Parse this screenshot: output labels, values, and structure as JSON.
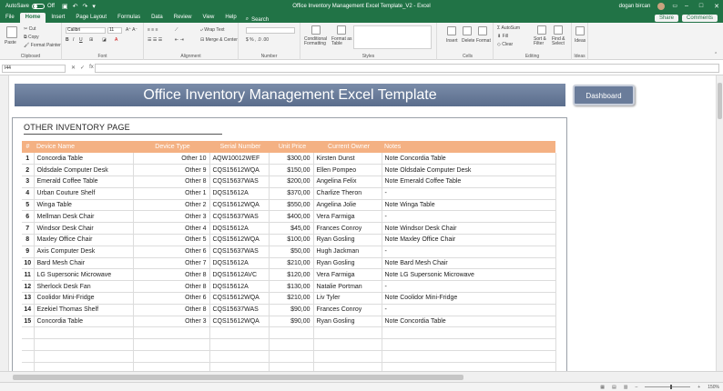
{
  "titlebar": {
    "autosave_label": "AutoSave",
    "autosave_state": "Off",
    "title": "Office Inventory Management Excel Template_V2 - Excel",
    "user": "dogan bircan"
  },
  "tabs": [
    "File",
    "Home",
    "Insert",
    "Page Layout",
    "Formulas",
    "Data",
    "Review",
    "View",
    "Help"
  ],
  "active_tab": "Home",
  "search_label": "Search",
  "share_label": "Share",
  "comments_label": "Comments",
  "ribbon": {
    "clipboard": {
      "paste": "Paste",
      "cut": "Cut",
      "copy": "Copy",
      "format_painter": "Format Painter",
      "label": "Clipboard"
    },
    "font": {
      "name": "Calibri",
      "size": "11",
      "label": "Font"
    },
    "alignment": {
      "wrap": "Wrap Text",
      "merge": "Merge & Center",
      "label": "Alignment"
    },
    "number": {
      "label": "Number"
    },
    "styles": {
      "conditional": "Conditional Formatting",
      "format_table": "Format as Table",
      "label": "Styles"
    },
    "cells": {
      "insert": "Insert",
      "delete": "Delete",
      "format": "Format",
      "label": "Cells"
    },
    "editing": {
      "autosum": "AutoSum",
      "fill": "Fill",
      "clear": "Clear",
      "sort": "Sort & Filter",
      "find": "Find & Select",
      "label": "Editing"
    },
    "ideas": {
      "ideas": "Ideas",
      "label": "Ideas"
    }
  },
  "formula_bar": {
    "name_box": "I44",
    "content": ""
  },
  "banner_title": "Office Inventory Management Excel Template",
  "dashboard_button": "Dashboard",
  "section_title": "OTHER INVENTORY PAGE",
  "table": {
    "headers": [
      "#",
      "Device Name",
      "Device Type",
      "Serial Number",
      "Unit Price",
      "Current Owner",
      "Notes"
    ],
    "rows": [
      [
        "1",
        "Concordia Table",
        "Other 10",
        "AQW10012WEF",
        "$300,00",
        "Kirsten Dunst",
        "Note Concordia Table"
      ],
      [
        "2",
        "Oldsdale Computer Desk",
        "Other 9",
        "CQS15612WQA",
        "$150,00",
        "Ellen Pompeo",
        "Note Oldsdale Computer Desk"
      ],
      [
        "3",
        "Emerald Coffee Table",
        "Other 8",
        "CQS15637WAS",
        "$200,00",
        "Angelina Felix",
        "Note Emerald Coffee Table"
      ],
      [
        "4",
        "Urban Couture Shelf",
        "Other 1",
        "DQS15612A",
        "$370,00",
        "Charlize Theron",
        "-"
      ],
      [
        "5",
        "Winga Table",
        "Other 2",
        "CQS15612WQA",
        "$550,00",
        "Angelina Jolie",
        "Note Winga Table"
      ],
      [
        "6",
        "Mellman Desk Chair",
        "Other 3",
        "CQS15637WAS",
        "$400,00",
        "Vera Farmiga",
        "-"
      ],
      [
        "7",
        "Windsor Desk Chair",
        "Other 4",
        "DQS15612A",
        "$45,00",
        "Frances Conroy",
        "Note Windsor Desk Chair"
      ],
      [
        "8",
        "Maxley Office Chair",
        "Other 5",
        "CQS15612WQA",
        "$100,00",
        "Ryan Gosling",
        "Note Maxley Office Chair"
      ],
      [
        "9",
        "Axis Computer Desk",
        "Other 6",
        "CQS15637WAS",
        "$50,00",
        "Hugh Jackman",
        "-"
      ],
      [
        "10",
        "Bard Mesh Chair",
        "Other 7",
        "DQS15612A",
        "$210,00",
        "Ryan Gosling",
        "Note Bard Mesh Chair"
      ],
      [
        "11",
        "LG Supersonic Microwave",
        "Other 8",
        "DQS15612AVC",
        "$120,00",
        "Vera Farmiga",
        "Note LG Supersonic Microwave"
      ],
      [
        "12",
        "Sherlock Desk Fan",
        "Other 8",
        "DQS15612A",
        "$130,00",
        "Natalie Portman",
        "-"
      ],
      [
        "13",
        "Coolidor Mini-Fridge",
        "Other 6",
        "CQS15612WQA",
        "$210,00",
        "Liv Tyler",
        "Note Coolidor Mini-Fridge"
      ],
      [
        "14",
        "Ezekiel Thomas Shelf",
        "Other 8",
        "CQS15637WAS",
        "$90,00",
        "Frances Conroy",
        "-"
      ],
      [
        "15",
        "Concordia Table",
        "Other 3",
        "CQS15612WQA",
        "$90,00",
        "Ryan Gosling",
        "Note Concordia Table"
      ]
    ],
    "empty_rows": 4
  },
  "status": {
    "zoom": "150%"
  },
  "colors": {
    "excel_green": "#217346",
    "header_orange": "#f4b183",
    "banner_blue": "#667a99"
  }
}
